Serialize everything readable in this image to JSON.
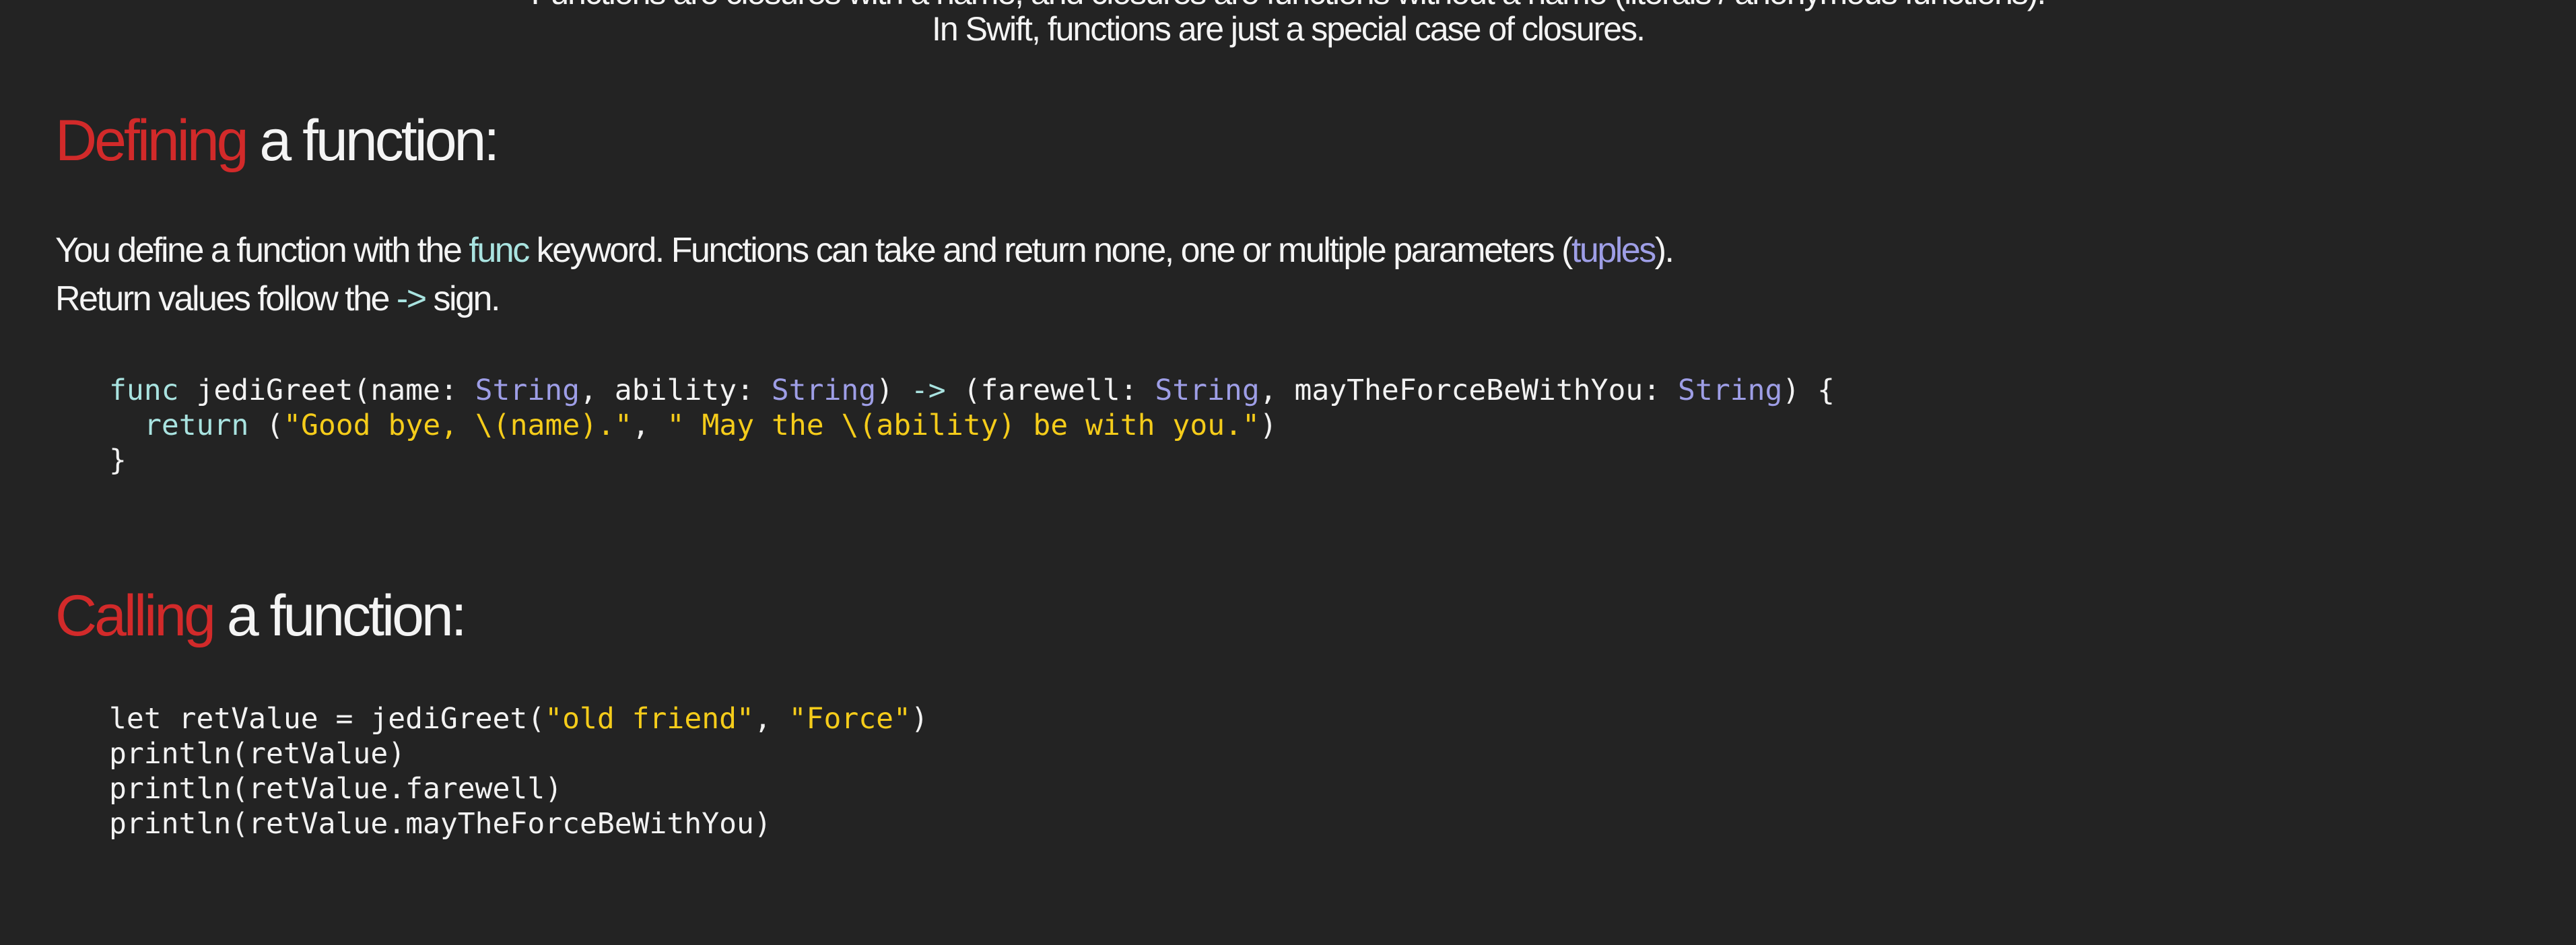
{
  "intro": {
    "line_cut": "Functions are closures with a name, and closures are functions without a name (literals / anonymous functions).",
    "line_main": "In Swift, functions are just a special case of closures."
  },
  "section_define": {
    "heading_accent": "Defining",
    "heading_rest": " a function:",
    "para1_a": "You define a function with the ",
    "para1_func": "func",
    "para1_b": " keyword. Functions can take and return none, one or multiple parameters (",
    "para1_tuples": "tuples",
    "para1_c": ").",
    "para2_a": "Return values follow the ",
    "para2_arrow": "->",
    "para2_b": " sign."
  },
  "code_define": {
    "l1": [
      {
        "t": "func",
        "k": "kw"
      },
      {
        "t": " jediGreet(name: ",
        "k": "plain"
      },
      {
        "t": "String",
        "k": "type"
      },
      {
        "t": ", ability: ",
        "k": "plain"
      },
      {
        "t": "String",
        "k": "type"
      },
      {
        "t": ") ",
        "k": "plain"
      },
      {
        "t": "->",
        "k": "op"
      },
      {
        "t": " (farewell: ",
        "k": "plain"
      },
      {
        "t": "String",
        "k": "type"
      },
      {
        "t": ", mayTheForceBeWithYou: ",
        "k": "plain"
      },
      {
        "t": "String",
        "k": "type"
      },
      {
        "t": ") {",
        "k": "plain"
      }
    ],
    "l2": [
      {
        "t": "return",
        "k": "kw"
      },
      {
        "t": " (",
        "k": "plain"
      },
      {
        "t": "\"Good bye, \\(name).\"",
        "k": "str"
      },
      {
        "t": ", ",
        "k": "plain"
      },
      {
        "t": "\" May the \\(ability) be with you.\"",
        "k": "str"
      },
      {
        "t": ")",
        "k": "plain"
      }
    ],
    "l3": [
      {
        "t": "}",
        "k": "plain"
      }
    ]
  },
  "section_call": {
    "heading_accent": "Calling",
    "heading_rest": " a function:"
  },
  "code_call": {
    "l1": [
      {
        "t": "let retValue = jediGreet(",
        "k": "plain"
      },
      {
        "t": "\"old friend\"",
        "k": "str"
      },
      {
        "t": ", ",
        "k": "plain"
      },
      {
        "t": "\"Force\"",
        "k": "str"
      },
      {
        "t": ")",
        "k": "plain"
      }
    ],
    "l2": [
      {
        "t": "println(retValue)",
        "k": "plain"
      }
    ],
    "l3": [
      {
        "t": "println(retValue.farewell)",
        "k": "plain"
      }
    ],
    "l4": [
      {
        "t": "println(retValue.mayTheForceBeWithYou)",
        "k": "plain"
      }
    ]
  },
  "colors": {
    "background": "#232323",
    "accent_red": "#d22a2a",
    "keyword_cyan": "#a9e3e0",
    "type_lavender": "#9e9ee6",
    "string_yellow": "#f5cc1a",
    "text": "#f2f2f2"
  }
}
